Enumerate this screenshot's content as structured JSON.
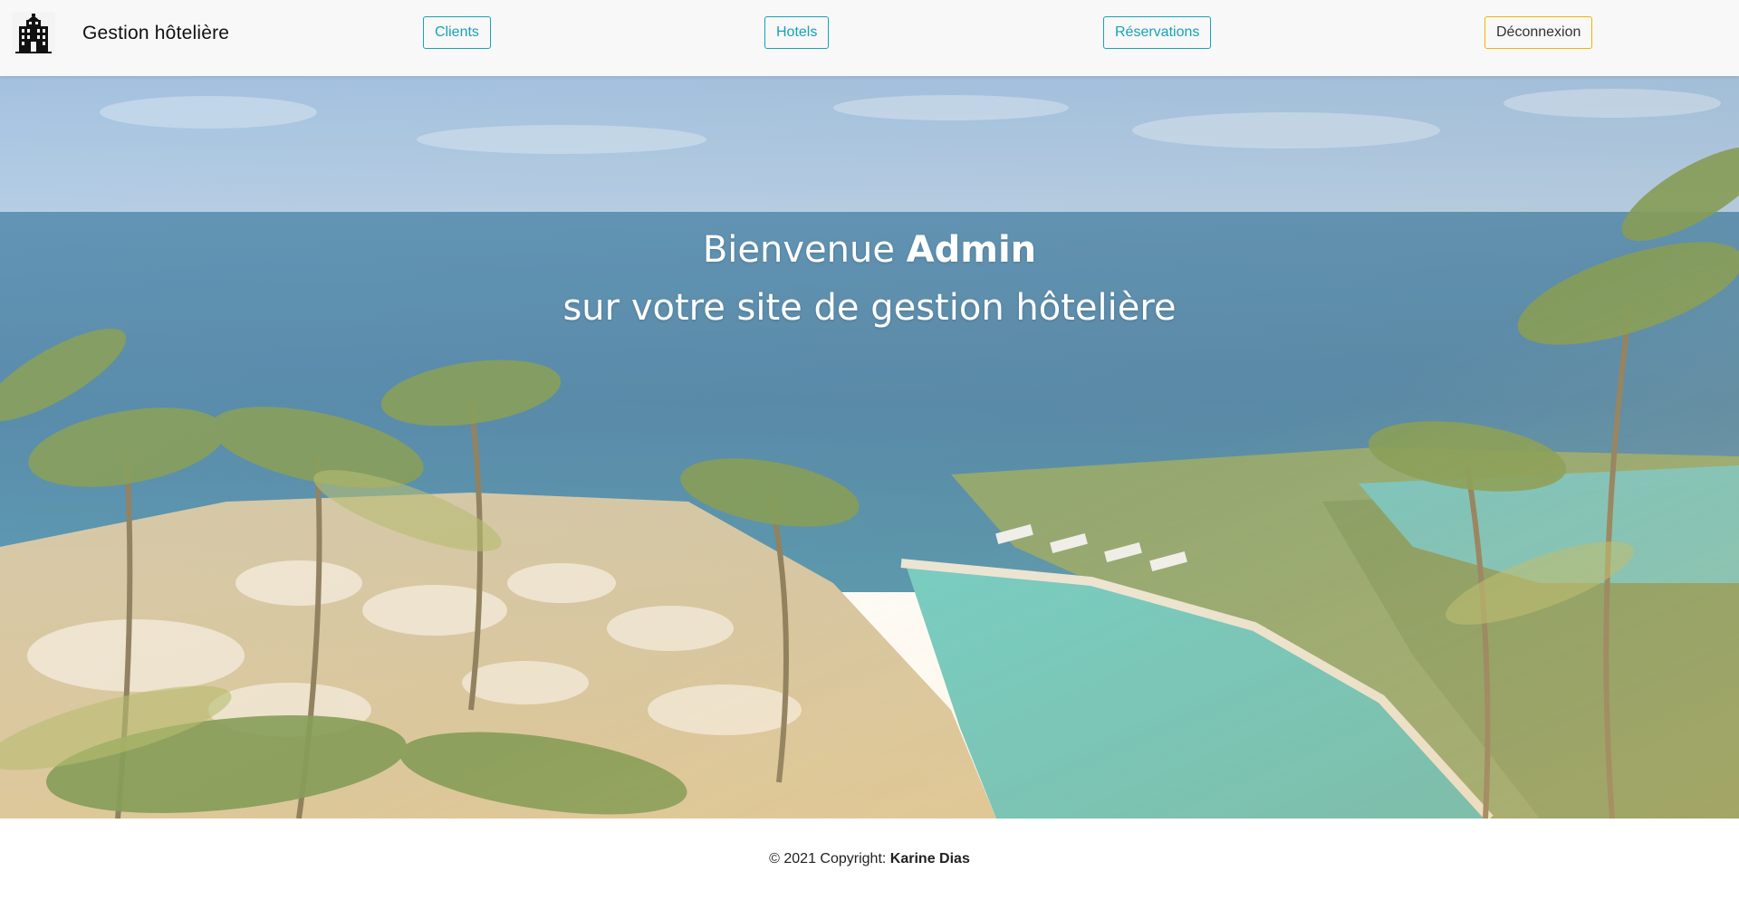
{
  "brand": {
    "name": "Gestion hôtelière",
    "logo_icon": "hotel-building-icon"
  },
  "nav": {
    "clients_label": "Clients",
    "hotels_label": "Hotels",
    "reservations_label": "Réservations",
    "logout_label": "Déconnexion"
  },
  "hero": {
    "greeting": "Bienvenue",
    "username": "Admin",
    "subtitle": "sur votre site de gestion hôtelière"
  },
  "footer": {
    "copyright": "© 2021 Copyright:",
    "author": "Karine Dias"
  },
  "colors": {
    "nav_background": "#f8f8f8",
    "info_accent": "#17a2b8",
    "warning_accent": "#f0b400",
    "hero_text": "#ffffff"
  }
}
